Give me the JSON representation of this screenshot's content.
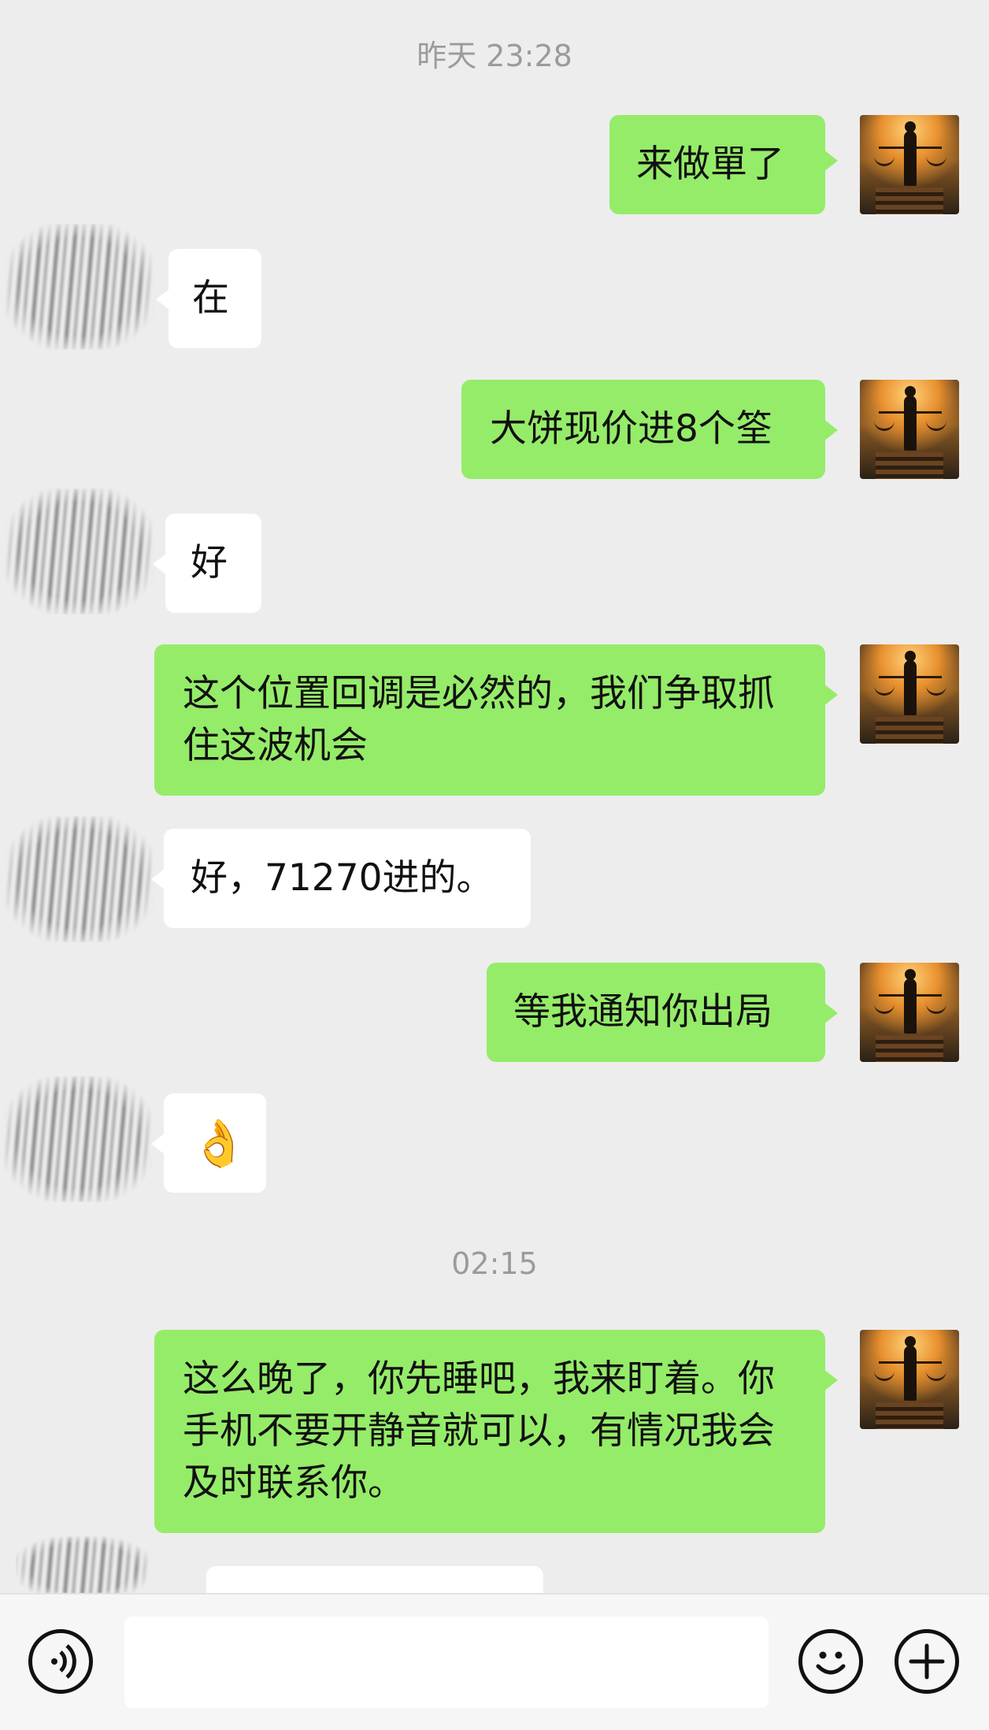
{
  "timestamps": {
    "first": "昨天 23:28",
    "second": "02:15"
  },
  "messages": [
    {
      "side": "me",
      "text": "来做單了"
    },
    {
      "side": "other",
      "text": "在"
    },
    {
      "side": "me",
      "text": "大饼现价进8个筌"
    },
    {
      "side": "other",
      "text": "好"
    },
    {
      "side": "me",
      "text": "这个位置回调是必然的，我们争取抓住这波机会"
    },
    {
      "side": "other",
      "text": "好，71270进的。"
    },
    {
      "side": "me",
      "text": "等我通知你出局"
    },
    {
      "side": "other",
      "text": "👌"
    },
    {
      "side": "me",
      "text": "这么晚了，你先睡吧，我来盯着。你手机不要开静音就可以，有情况我会及时联系你。"
    }
  ],
  "input": {
    "value": "",
    "voice_icon": "voice-icon",
    "emoji_icon": "emoji-icon",
    "add_icon": "plus-icon"
  },
  "colors": {
    "background": "#ededed",
    "my_bubble": "#95ec69",
    "their_bubble": "#ffffff",
    "timestamp": "#9b9b9b"
  }
}
